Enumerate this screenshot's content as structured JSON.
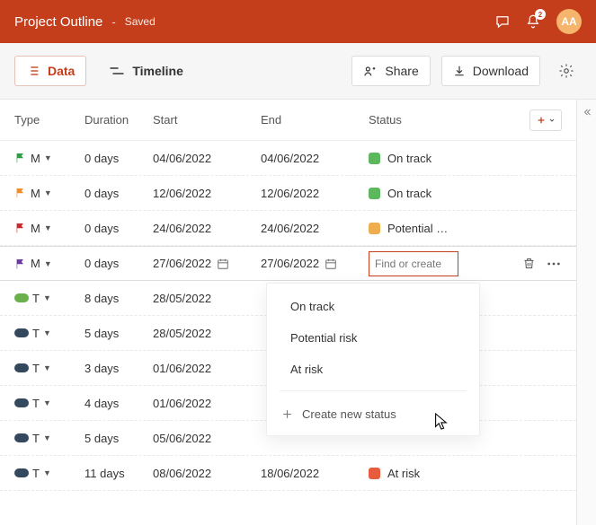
{
  "header": {
    "title": "Project Outline",
    "saved_label": "Saved",
    "notification_count": "2",
    "avatar_initials": "AA"
  },
  "toolbar": {
    "data_label": "Data",
    "timeline_label": "Timeline",
    "share_label": "Share",
    "download_label": "Download"
  },
  "columns": {
    "type": "Type",
    "duration": "Duration",
    "start": "Start",
    "end": "End",
    "status": "Status"
  },
  "rows": [
    {
      "marker_shape": "flag",
      "marker_color": "#2e9e45",
      "type_label": "M",
      "duration": "0 days",
      "start": "04/06/2022",
      "end": "04/06/2022",
      "status_color": "#5cb85c",
      "status_label": "On track"
    },
    {
      "marker_shape": "flag",
      "marker_color": "#f28c28",
      "type_label": "M",
      "duration": "0 days",
      "start": "12/06/2022",
      "end": "12/06/2022",
      "status_color": "#5cb85c",
      "status_label": "On track"
    },
    {
      "marker_shape": "flag",
      "marker_color": "#cc2b2b",
      "type_label": "M",
      "duration": "0 days",
      "start": "24/06/2022",
      "end": "24/06/2022",
      "status_color": "#f0ad4e",
      "status_label": "Potential …"
    },
    {
      "marker_shape": "flag",
      "marker_color": "#6b3aa0",
      "type_label": "M",
      "duration": "0 days",
      "start": "27/06/2022",
      "end": "27/06/2022",
      "editing": true
    },
    {
      "marker_shape": "pill",
      "marker_color": "#6ab04c",
      "type_label": "T",
      "duration": "8 days",
      "start": "28/05/2022",
      "end": ""
    },
    {
      "marker_shape": "pill",
      "marker_color": "#34495e",
      "type_label": "T",
      "duration": "5 days",
      "start": "28/05/2022",
      "end": ""
    },
    {
      "marker_shape": "pill",
      "marker_color": "#34495e",
      "type_label": "T",
      "duration": "3 days",
      "start": "01/06/2022",
      "end": ""
    },
    {
      "marker_shape": "pill",
      "marker_color": "#34495e",
      "type_label": "T",
      "duration": "4 days",
      "start": "01/06/2022",
      "end": ""
    },
    {
      "marker_shape": "pill",
      "marker_color": "#34495e",
      "type_label": "T",
      "duration": "5 days",
      "start": "05/06/2022",
      "end": ""
    },
    {
      "marker_shape": "pill",
      "marker_color": "#34495e",
      "type_label": "T",
      "duration": "11 days",
      "start": "08/06/2022",
      "end": "18/06/2022",
      "status_color": "#e65c3c",
      "status_label": "At risk"
    }
  ],
  "status_input_placeholder": "Find or create",
  "status_options": [
    {
      "color": "#5cb85c",
      "label": "On track"
    },
    {
      "color": "#f0ad4e",
      "label": "Potential risk"
    },
    {
      "color": "#e65c3c",
      "label": "At risk"
    }
  ],
  "create_new_label": "Create new status"
}
